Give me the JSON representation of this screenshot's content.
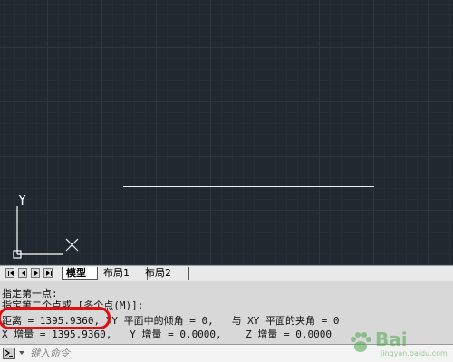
{
  "tabs": {
    "model": "模型",
    "layout1": "布局1",
    "layout2": "布局2"
  },
  "ucs": {
    "y_label": "Y"
  },
  "history": {
    "lines": [
      "指定第一点:",
      "指定第二个点或 [多个点(M)]:",
      "距离 = 1395.9360, XY 平面中的倾角 = 0,   与 XY 平面的夹角 = 0",
      "X 增量 = 1395.9360,   Y 增量 = 0.0000,    Z 增量 = 0.0000"
    ]
  },
  "command": {
    "placeholder": "键入命令"
  },
  "watermark": {
    "brand": "Bai",
    "sub": "jingyan.baidu.com"
  },
  "colors": {
    "background": "#212830",
    "highlight": "#e01010",
    "watermark": "#4da84d"
  },
  "icons": {
    "nav_first": "first-icon",
    "nav_prev": "previous-icon",
    "nav_next": "next-icon",
    "nav_last": "last-icon",
    "command": "command-line-icon",
    "dropdown": "dropdown-icon"
  }
}
